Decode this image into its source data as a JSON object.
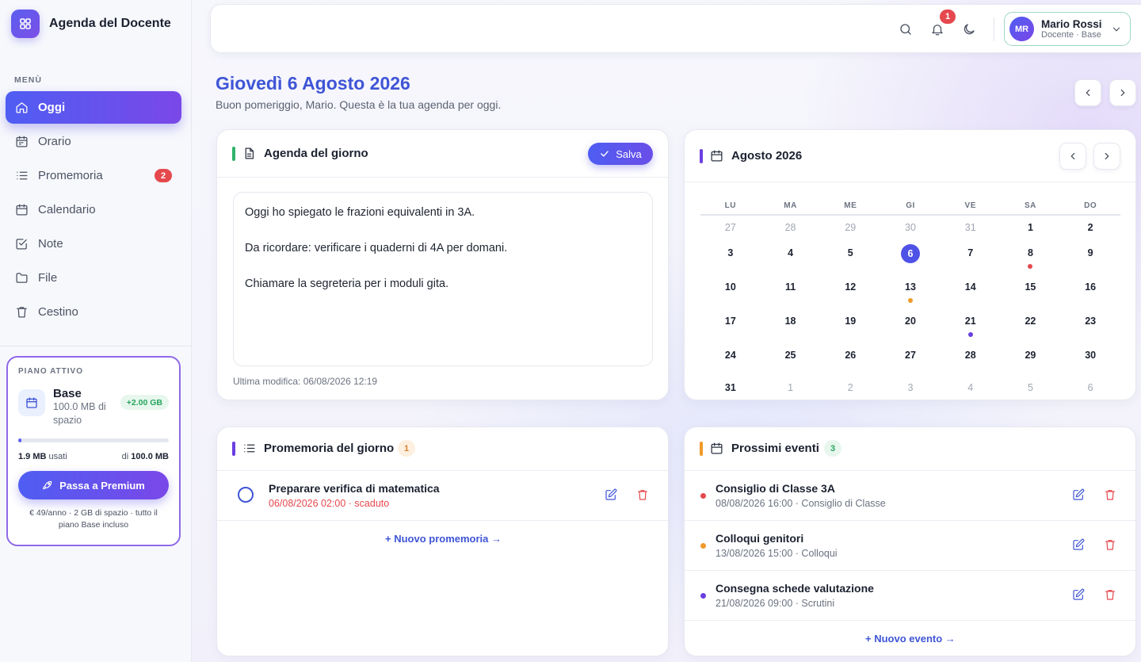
{
  "app": {
    "name": "Agenda del Docente"
  },
  "sidebar": {
    "menu_label": "MENÙ",
    "items": [
      {
        "label": "Oggi",
        "icon": "home-icon",
        "active": true
      },
      {
        "label": "Orario",
        "icon": "calendar-clock-icon"
      },
      {
        "label": "Promemoria",
        "icon": "list-icon",
        "badge": "2"
      },
      {
        "label": "Calendario",
        "icon": "calendar-icon"
      },
      {
        "label": "Note",
        "icon": "checkbox-icon"
      },
      {
        "label": "File",
        "icon": "folder-icon"
      },
      {
        "label": "Cestino",
        "icon": "trash-icon"
      }
    ],
    "plan": {
      "label": "PIANO ATTIVO",
      "name": "Base",
      "space": "100.0 MB di spazio",
      "extra": "+2.00 GB",
      "used": "1.9 MB",
      "used_suffix": "usati",
      "total_prefix": "di",
      "total": "100.0 MB",
      "usage_fraction": 0.019,
      "upgrade_label": "Passa a Premium",
      "note": "€ 49/anno · 2 GB di spazio · tutto il piano Base incluso"
    }
  },
  "header": {
    "notifications_count": "1",
    "user": {
      "initials": "MR",
      "name": "Mario Rossi",
      "role": "Docente · Base"
    }
  },
  "page": {
    "title": "Giovedì 6 Agosto 2026",
    "subtitle": "Buon pomeriggio, Mario. Questa è la tua agenda per oggi."
  },
  "agenda": {
    "title": "Agenda del giorno",
    "save_label": "Salva",
    "lines": [
      "Oggi ho spiegato le frazioni equivalenti in 3A.",
      "Da ricordare: verificare i quaderni di 4A per domani.",
      "Chiamare la segreteria per i moduli gita."
    ],
    "last_edit": "Ultima modifica: 06/08/2026 12:19"
  },
  "calendar": {
    "title": "Agosto 2026",
    "weekdays": [
      "LU",
      "MA",
      "ME",
      "GI",
      "VE",
      "SA",
      "DO"
    ],
    "weeks": [
      [
        {
          "d": "27",
          "m": true
        },
        {
          "d": "28",
          "m": true
        },
        {
          "d": "29",
          "m": true
        },
        {
          "d": "30",
          "m": true
        },
        {
          "d": "31",
          "m": true
        },
        {
          "d": "1"
        },
        {
          "d": "2"
        }
      ],
      [
        {
          "d": "3"
        },
        {
          "d": "4"
        },
        {
          "d": "5"
        },
        {
          "d": "6",
          "today": true
        },
        {
          "d": "7"
        },
        {
          "d": "8",
          "dot": "#e5484d"
        },
        {
          "d": "9"
        }
      ],
      [
        {
          "d": "10"
        },
        {
          "d": "11"
        },
        {
          "d": "12"
        },
        {
          "d": "13",
          "dot": "#ef9a2b"
        },
        {
          "d": "14"
        },
        {
          "d": "15"
        },
        {
          "d": "16"
        }
      ],
      [
        {
          "d": "17"
        },
        {
          "d": "18"
        },
        {
          "d": "19"
        },
        {
          "d": "20"
        },
        {
          "d": "21",
          "dot": "#6a3fe0"
        },
        {
          "d": "22"
        },
        {
          "d": "23"
        }
      ],
      [
        {
          "d": "24"
        },
        {
          "d": "25"
        },
        {
          "d": "26"
        },
        {
          "d": "27"
        },
        {
          "d": "28"
        },
        {
          "d": "29"
        },
        {
          "d": "30"
        }
      ],
      [
        {
          "d": "31"
        },
        {
          "d": "1",
          "m": true
        },
        {
          "d": "2",
          "m": true
        },
        {
          "d": "3",
          "m": true
        },
        {
          "d": "4",
          "m": true
        },
        {
          "d": "5",
          "m": true
        },
        {
          "d": "6",
          "m": true
        }
      ]
    ]
  },
  "reminders": {
    "title": "Promemoria del giorno",
    "count": "1",
    "items": [
      {
        "title": "Preparare verifica di matematica",
        "sub": "06/08/2026 02:00 · scaduto"
      }
    ],
    "add_label": "+ Nuovo promemoria →"
  },
  "events": {
    "title": "Prossimi eventi",
    "count": "3",
    "items": [
      {
        "title": "Consiglio di Classe 3A",
        "sub": "08/08/2026 16:00 · Consiglio di Classe",
        "color": "#e5484d"
      },
      {
        "title": "Colloqui genitori",
        "sub": "13/08/2026 15:00 · Colloqui",
        "color": "#ef9a2b"
      },
      {
        "title": "Consegna schede valutazione",
        "sub": "21/08/2026 09:00 · Scrutini",
        "color": "#6a3fe0"
      }
    ],
    "add_label": "+ Nuovo evento →"
  },
  "colors": {
    "accent": "#4f5df2",
    "title_blue": "#3f55d6",
    "danger": "#e5484d"
  }
}
